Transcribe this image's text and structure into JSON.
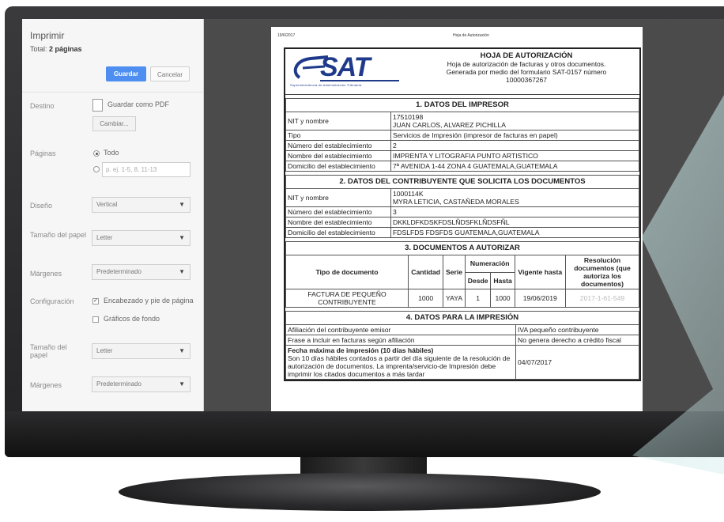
{
  "print_panel": {
    "title": "Imprimir",
    "total_label": "Total:",
    "total_value": "2 páginas",
    "save_label": "Guardar",
    "cancel_label": "Cancelar",
    "destination_label": "Destino",
    "destination_value": "Guardar como PDF",
    "change_label": "Cambiar...",
    "pages_label": "Páginas",
    "pages_all": "Todo",
    "pages_placeholder": "p. ej. 1-5, 8, 11-13",
    "layout_label": "Diseño",
    "layout_value": "Vertical",
    "paper_size_label": "Tamaño del papel",
    "paper_size_value": "Letter",
    "margins_label": "Márgenes",
    "margins_value": "Predeterminado",
    "config_label": "Configuración",
    "header_footer_option": "Encabezado y pie de página",
    "header_footer_checked": true,
    "background_option": "Gráficos de fondo",
    "background_checked": false,
    "paper_size2_label": "Tamaño del papel",
    "paper_size2_value": "Letter",
    "margins2_label": "Márgenes",
    "margins2_value": "Predeterminado"
  },
  "document": {
    "print_date": "19/6/2017",
    "print_title": "Hoja de Autorización",
    "logo_text": "SAT",
    "logo_sub": "Superintendencia de Administración Tributaria",
    "heading": "HOJA DE AUTORIZACIÓN",
    "heading_l1": "Hoja de autorización de facturas y otros documentos.",
    "heading_l2": "Generada por medio del formulario SAT-0157 número",
    "heading_number": "10000367267",
    "s1_title": "1. DATOS DEL IMPRESOR",
    "s1_nit_label": "NIT y nombre",
    "s1_nit": "17510198",
    "s1_name": "JUAN CARLOS, ALVAREZ PICHILLA",
    "s1_tipo_label": "Tipo",
    "s1_tipo": "Servicios de Impresión (impresor de facturas en papel)",
    "s1_num_label": "Número del establecimiento",
    "s1_num": "2",
    "s1_nombre_label": "Nombre del establecimiento",
    "s1_nombre": "IMPRENTA Y LITOGRAFIA PUNTO ARTISTICO",
    "s1_dom_label": "Domicilio del establecimiento",
    "s1_dom": "7ª AVENIDA 1-44 ZONA 4 GUATEMALA,GUATEMALA",
    "s2_title": "2. DATOS DEL CONTRIBUYENTE QUE SOLICITA LOS DOCUMENTOS",
    "s2_nit_label": "NIT y nombre",
    "s2_nit": "1000114K",
    "s2_name": "MYRA LETICIA, CASTAÑEDA MORALES",
    "s2_num_label": "Número del establecimiento",
    "s2_num": "3",
    "s2_nombre_label": "Nombre del establecimiento",
    "s2_nombre": "DKKLDFKDSKFDSLÑDSFKLÑDSFÑL",
    "s2_dom_label": "Domicilio del establecimiento",
    "s2_dom": "FDSLFDS FDSFDS GUATEMALA,GUATEMALA",
    "s3_title": "3. DOCUMENTOS A AUTORIZAR",
    "s3_col_tipo": "Tipo de documento",
    "s3_col_cantidad": "Cantidad",
    "s3_col_serie": "Serie",
    "s3_col_numeracion": "Numeración",
    "s3_col_desde": "Desde",
    "s3_col_hasta": "Hasta",
    "s3_col_vigente": "Vigente hasta",
    "s3_col_resolucion": "Resolución documentos (que autoriza los documentos)",
    "s3_row_tipo": "FACTURA DE PEQUEÑO CONTRIBUYENTE",
    "s3_row_cantidad": "1000",
    "s3_row_serie": "YAYA",
    "s3_row_desde": "1",
    "s3_row_hasta": "1000",
    "s3_row_vigente": "19/06/2019",
    "s3_row_resolucion": "2017-1-61-549",
    "s4_title": "4. DATOS PARA LA IMPRESIÓN",
    "s4_afil_label": "Afiliación del contribuyente emisor",
    "s4_afil": "IVA pequeño contribuyente",
    "s4_frase_label": "Frase a incluir en facturas según afiliación",
    "s4_frase": "No genera derecho a crédito fiscal",
    "s4_fecha_label": "Fecha máxima de impresión (10 días hábiles)",
    "s4_fecha_desc": "Son 10 días hábiles contados a partir del día siguiente de la resolución de autorización de documentos. La imprenta/servicio-de Impresión debe imprimir los citados documentos a más tardar",
    "s4_fecha": "04/07/2017"
  }
}
